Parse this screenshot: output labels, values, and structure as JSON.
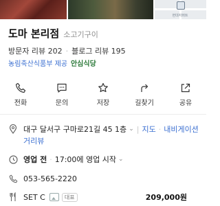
{
  "place": {
    "name": "도마 본리점",
    "category": "소고기구이",
    "visitor_reviews": "방문자 리뷰 202",
    "blog_reviews": "블로그 리뷰 195",
    "provider_text": "농림축산식품부 제공",
    "provider_logo": "안심식당"
  },
  "map_thumb": {
    "label": "현대자퍼트"
  },
  "actions": [
    {
      "label": "전화",
      "icon": "phone-icon"
    },
    {
      "label": "문의",
      "icon": "chat-icon"
    },
    {
      "label": "저장",
      "icon": "star-icon"
    },
    {
      "label": "길찾기",
      "icon": "directions-icon"
    },
    {
      "label": "공유",
      "icon": "share-icon"
    }
  ],
  "info": {
    "address": "대구 달서구 구마로21길 45 1층",
    "map_link": "지도",
    "navi_link": "내비게이션",
    "street_view": "거리뷰",
    "hours_status": "영업 전",
    "hours_detail": "17:00에 영업 시작",
    "phone": "053-565-2220",
    "menu_name": "SET C",
    "menu_badge": "대표",
    "menu_price": "209,000원"
  },
  "colors": {
    "link": "#3b6fd1",
    "logo": "#2d7a3a"
  }
}
